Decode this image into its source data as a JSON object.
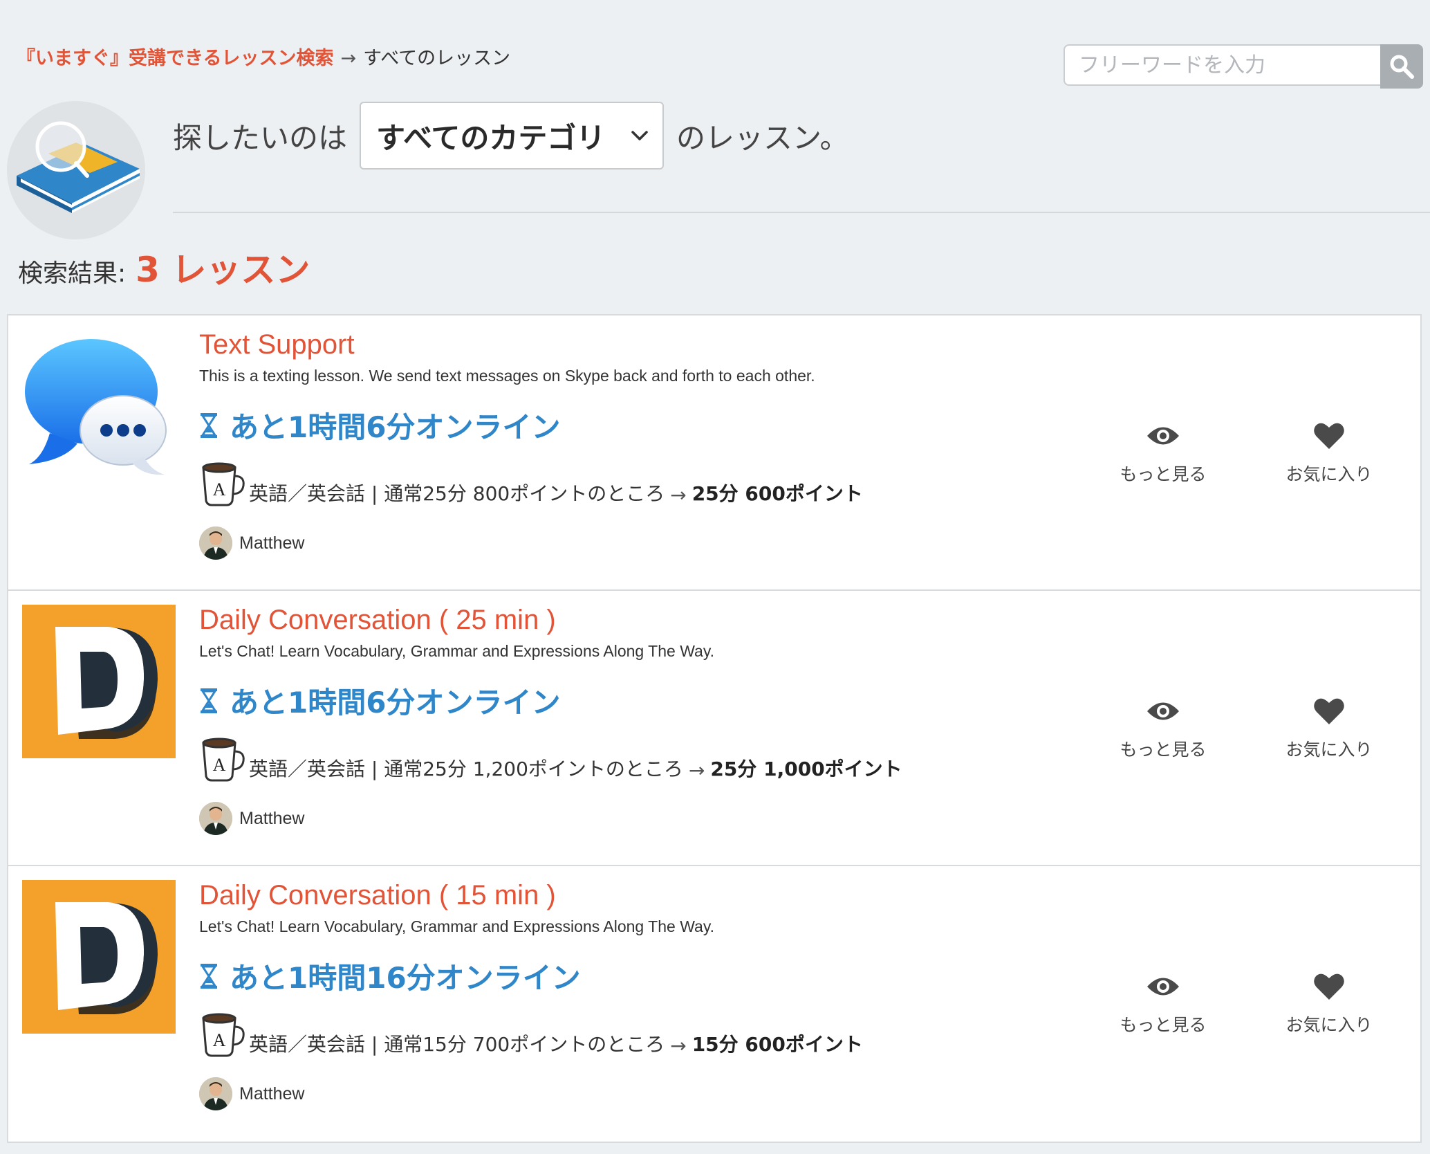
{
  "breadcrumb": {
    "link": "『いますぐ』受講できるレッスン検索",
    "separator": "→",
    "current": "すべてのレッスン"
  },
  "search": {
    "placeholder": "フリーワードを入力",
    "icon": "search-icon"
  },
  "category": {
    "prefix": "探したいのは",
    "selected": "すべてのカテゴリ",
    "suffix": "のレッスン。"
  },
  "result": {
    "label": "検索結果:",
    "count": "3 レッスン"
  },
  "colors": {
    "accent": "#e15438",
    "link_blue": "#2f86c9",
    "background": "#edf0f2"
  },
  "lessons": [
    {
      "title": "Text Support",
      "description": "This is a texting lesson. We send text messages on Skype back and forth to each other.",
      "online": "あと1時間6分オンライン",
      "category": "英語／英会話 | 通常25分 800ポイントのところ",
      "arrow": "→",
      "deal": "25分 600ポイント",
      "teacher": "Matthew",
      "more_label": "もっと見る",
      "fav_label": "お気に入り",
      "thumb": "messages-app-icon"
    },
    {
      "title": "Daily Conversation ( 25 min )",
      "description": "Let's Chat! Learn Vocabulary, Grammar and Expressions Along The Way.",
      "online": "あと1時間6分オンライン",
      "category": "英語／英会話 | 通常25分 1,200ポイントのところ",
      "arrow": "→",
      "deal": "25分 1,000ポイント",
      "teacher": "Matthew",
      "more_label": "もっと見る",
      "fav_label": "お気に入り",
      "thumb": "letter-d-logo"
    },
    {
      "title": "Daily Conversation ( 15 min )",
      "description": "Let's Chat! Learn Vocabulary, Grammar and Expressions Along The Way.",
      "online": "あと1時間16分オンライン",
      "category": "英語／英会話 | 通常15分 700ポイントのところ",
      "arrow": "→",
      "deal": "15分 600ポイント",
      "teacher": "Matthew",
      "more_label": "もっと見る",
      "fav_label": "お気に入り",
      "thumb": "letter-d-logo"
    }
  ]
}
